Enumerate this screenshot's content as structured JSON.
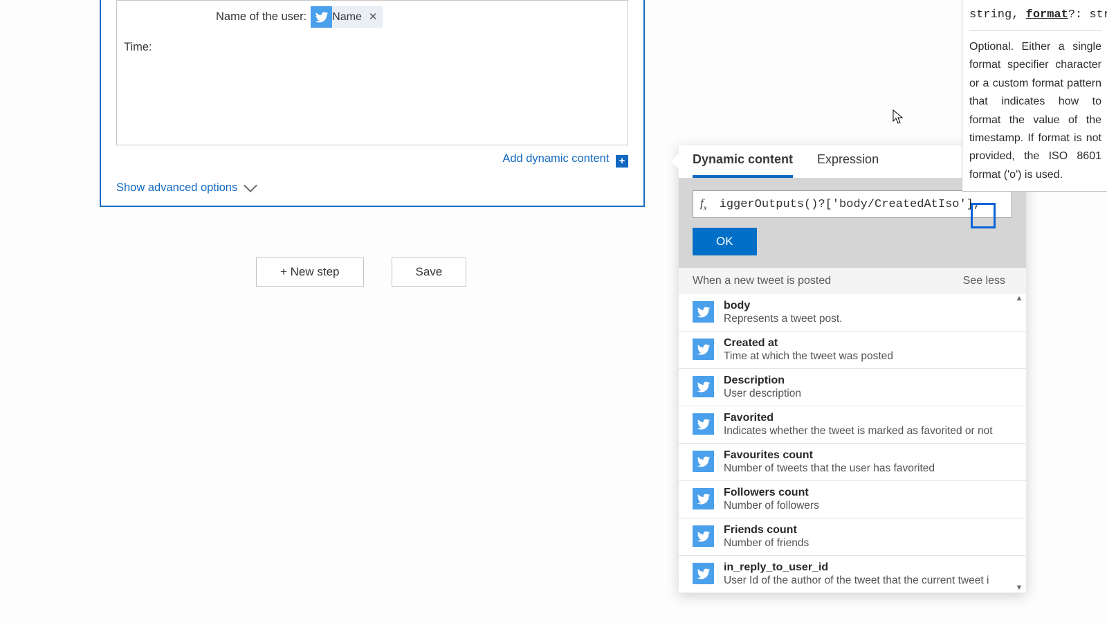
{
  "card": {
    "line1_label": "Name of the user:",
    "token_name": "Name",
    "line2_label": "Time:",
    "add_dyn_label": "Add dynamic content",
    "show_adv_label": "Show advanced options"
  },
  "buttons": {
    "new_step": "+ New step",
    "save": "Save"
  },
  "popup": {
    "tab_dynamic": "Dynamic content",
    "tab_expression": "Expression",
    "fx_value": "iggerOutputs()?['body/CreatedAtIso'],",
    "ok_label": "OK",
    "section_title": "When a new tweet is posted",
    "see_label": "See less",
    "items": [
      {
        "title": "body",
        "desc": "Represents a tweet post."
      },
      {
        "title": "Created at",
        "desc": "Time at which the tweet was posted"
      },
      {
        "title": "Description",
        "desc": "User description"
      },
      {
        "title": "Favorited",
        "desc": "Indicates whether the tweet is marked as favorited or not"
      },
      {
        "title": "Favourites count",
        "desc": "Number of tweets that the user has favorited"
      },
      {
        "title": "Followers count",
        "desc": "Number of followers"
      },
      {
        "title": "Friends count",
        "desc": "Number of friends"
      },
      {
        "title": "in_reply_to_user_id",
        "desc": "User Id of the author of the tweet that the current tweet i"
      }
    ]
  },
  "tooltip": {
    "sig_pre": "string, ",
    "sig_kw": "format",
    "sig_post": "?: str",
    "body": "Optional. Either a single format specifier character or a custom format pattern that indicates how to format the value of the timestamp. If format is not provided, the ISO 8601 format ('o') is used."
  }
}
